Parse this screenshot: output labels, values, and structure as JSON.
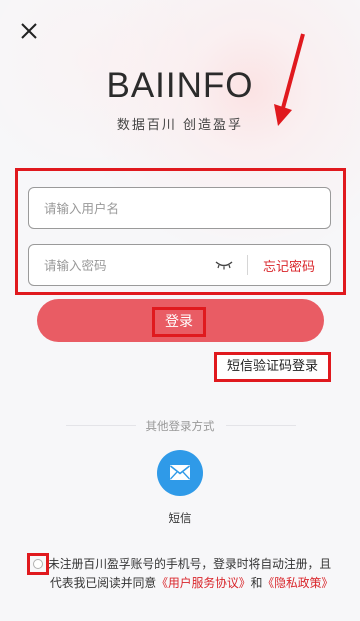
{
  "header": {
    "close_icon": "close-icon"
  },
  "brand": {
    "logo": "BAIINFO",
    "slogan": "数据百川  创造盈孚"
  },
  "form": {
    "username_placeholder": "请输入用户名",
    "password_placeholder": "请输入密码",
    "forgot_password": "忘记密码",
    "visibility_icon": "eye-closed-icon"
  },
  "actions": {
    "login": "登录",
    "sms_code_login": "短信验证码登录"
  },
  "other_methods": {
    "title": "其他登录方式",
    "sms_label": "短信",
    "sms_icon": "mail-icon"
  },
  "agreement": {
    "text_1": "未注册百川盈孚账号的手机号，登录时将自动注册，且",
    "text_2": "代表我已阅读并同意",
    "service_agreement": "《用户服务协议》",
    "and": "和",
    "privacy_policy": "《隐私政策》"
  },
  "colors": {
    "accent": "#d9262b",
    "login_button": "#e95c64",
    "sms_icon_bg": "#2f9ae8",
    "annotation_red": "#e0191e"
  }
}
